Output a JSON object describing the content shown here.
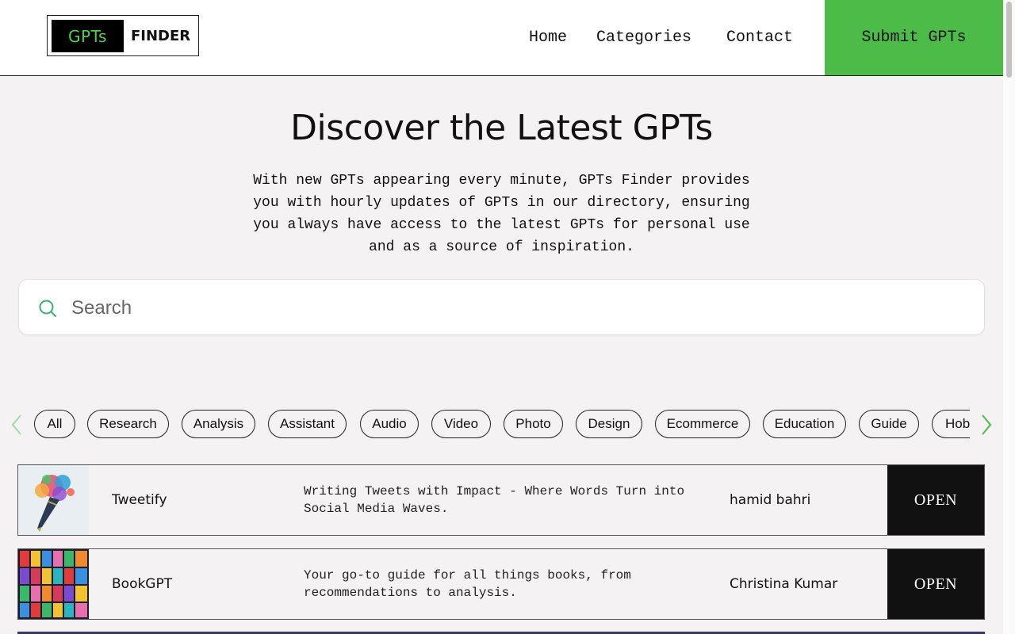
{
  "header": {
    "logo_left": "GPTs",
    "logo_right": "FINDER",
    "nav": [
      "Home",
      "Categories",
      "Contact"
    ],
    "submit_label": "Submit GPTs"
  },
  "hero": {
    "title": "Discover the Latest GPTs",
    "description_lines": [
      "With new GPTs appearing every minute, GPTs Finder provides",
      "you with hourly updates of GPTs in our directory, ensuring",
      "you always have access to the latest GPTs for personal use",
      "and as a source of inspiration."
    ]
  },
  "search": {
    "placeholder": "Search",
    "value": ""
  },
  "categories": [
    "All",
    "Research",
    "Analysis",
    "Assistant",
    "Audio",
    "Video",
    "Photo",
    "Design",
    "Ecommerce",
    "Education",
    "Guide",
    "Hob"
  ],
  "gpts": [
    {
      "name": "Tweetify",
      "description_lines": [
        "Writing Tweets with Impact - Where Words Turn into",
        "Social Media Waves."
      ],
      "author": "hamid bahri",
      "action": "OPEN",
      "icon": "colorful-fountain-pen-image"
    },
    {
      "name": "BookGPT",
      "description_lines": [
        "Your go-to guide for all things books, from",
        "recommendations to analysis."
      ],
      "author": "Christina Kumar",
      "action": "OPEN",
      "icon": "book-covers-mosaic-image"
    }
  ],
  "colors": {
    "accent_green": "#4cbb47",
    "logo_green": "#4fd04a",
    "background": "#f4f2f3",
    "button_dark": "#111111"
  }
}
